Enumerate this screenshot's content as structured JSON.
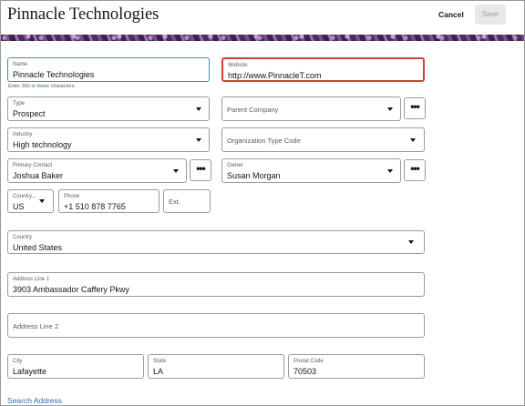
{
  "header": {
    "title": "Pinnacle Technologies",
    "cancel_label": "Cancel",
    "save_label": "Save"
  },
  "form": {
    "name": {
      "label": "Name",
      "value": "Pinnacle Technologies",
      "hint": "Enter 360 or fewer characters."
    },
    "website": {
      "label": "Website",
      "value": "http://www.PinnacleT.com"
    },
    "type": {
      "label": "Type",
      "value": "Prospect"
    },
    "parent_company": {
      "placeholder": "Parent Company"
    },
    "industry": {
      "label": "Industry",
      "value": "High technology"
    },
    "organization_type_code": {
      "placeholder": "Organization Type Code"
    },
    "primary_contact": {
      "label": "Primary Contact",
      "value": "Joshua Baker"
    },
    "owner": {
      "label": "Owner",
      "value": "Susan Morgan"
    },
    "phone_country": {
      "label": "Country...",
      "value": "US"
    },
    "phone": {
      "label": "Phone",
      "value": "+1 510 878 7765"
    },
    "ext": {
      "placeholder": "Ext."
    },
    "country": {
      "label": "Country",
      "value": "United States"
    },
    "address_line_1": {
      "label": "Address Line 1",
      "value": "3903 Ambassador Caffery Pkwy"
    },
    "address_line_2": {
      "placeholder": "Address Line 2"
    },
    "city": {
      "label": "City",
      "value": "Lafayette"
    },
    "state": {
      "label": "State",
      "value": "LA"
    },
    "postal_code": {
      "label": "Postal Code",
      "value": "70503"
    },
    "more_icon_glyph": "•••",
    "search_address_label": "Search Address"
  },
  "colors": {
    "error_border": "#c74634",
    "focus_border": "#4c8c9a",
    "link": "#2b6cb0"
  }
}
